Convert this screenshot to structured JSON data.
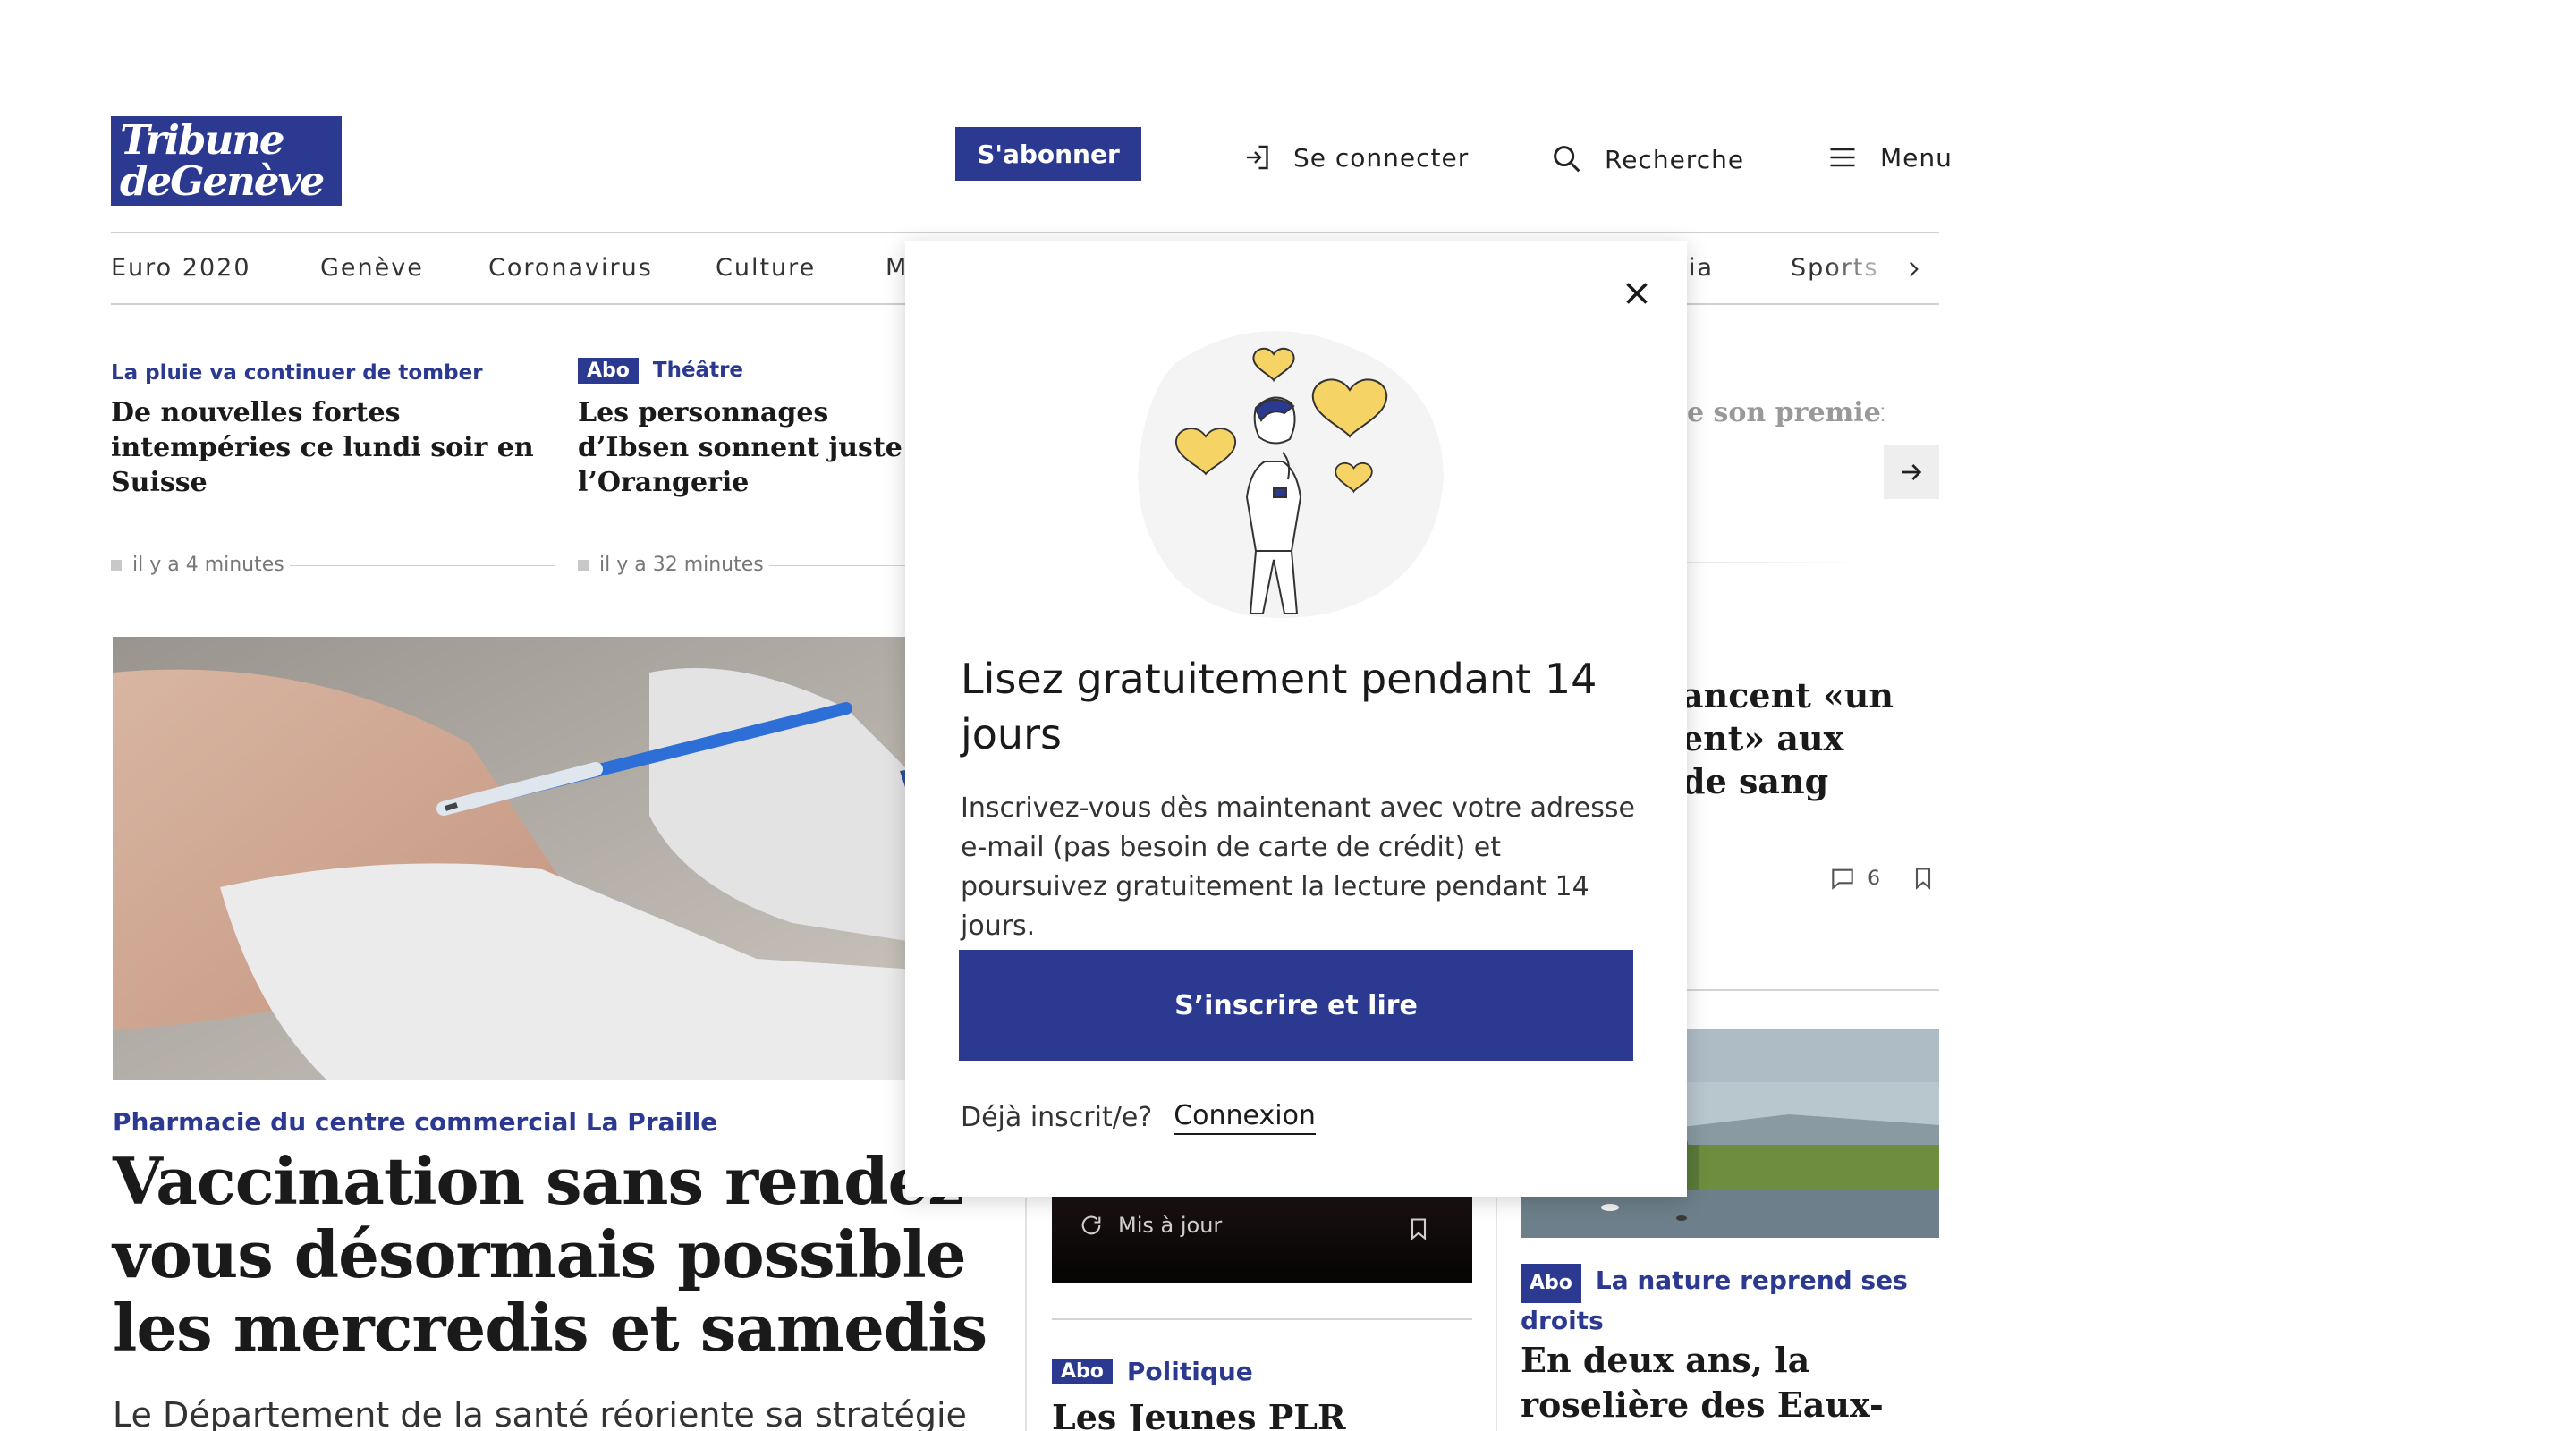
{
  "header": {
    "logo_line1": "Tribune",
    "logo_line2": "deGenève",
    "subscribe_label": "S'abonner",
    "login_label": "Se connecter",
    "search_label": "Recherche",
    "menu_label": "Menu"
  },
  "nav": {
    "items": [
      "Euro 2020",
      "Genève",
      "Coronavirus",
      "Culture",
      "Mo",
      "ia",
      "Sports"
    ]
  },
  "ticker": [
    {
      "kicker": "La pluie va continuer de tomber",
      "headline": "De nouvelles fortes intempéries ce lundi soir en Suisse",
      "time": "il y a 4 minutes"
    },
    {
      "badge": "Abo",
      "kicker": "Théâtre",
      "headline": "Les personnages d’Ibsen sonnent juste à l’Orangerie",
      "time": "il y a 32 minutes"
    },
    {
      "headline_partial": "e son premier"
    }
  ],
  "lead": {
    "kicker": "Pharmacie du centre commercial La Praille",
    "headline": "Vaccination sans rendez-vous désormais possible les mercredis et samedis",
    "teaser": "Le Département de la santé réoriente sa stratégie"
  },
  "middle": {
    "video_label": "Mis à jour",
    "badge": "Abo",
    "kicker": "Politique",
    "headline": "Les Jeunes PLR"
  },
  "right": {
    "headline_partial": "ancent «un\nent» aux\nde sang",
    "comments_count": "6",
    "badge": "Abo",
    "kicker": "La nature reprend ses droits",
    "headline": "En deux ans, la roselière des Eaux-Vives est"
  },
  "modal": {
    "title": "Lisez gratuitement pendant 14 jours",
    "body": "Inscrivez-vous dès maintenant avec votre adresse e-mail (pas besoin de carte de crédit) et poursuivez gratuitement la lecture pendant 14 jours.",
    "cta_label": "S’inscrire et lire",
    "footer_text": "Déjà inscrit/e?",
    "footer_link": "Connexion"
  },
  "colors": {
    "brand": "#2b3990",
    "heart": "#f5d364"
  }
}
